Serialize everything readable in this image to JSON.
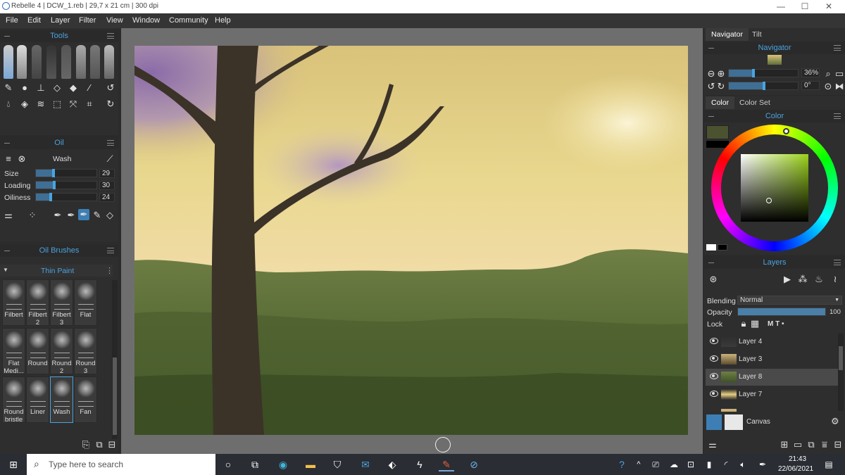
{
  "window": {
    "title": "Rebelle 4 | DCW_1.reb | 29,7 x 21 cm | 300 dpi",
    "min": "—",
    "max": "☐",
    "close": "✕"
  },
  "menu": [
    "File",
    "Edit",
    "Layer",
    "Filter",
    "View",
    "Window",
    "Community",
    "Help"
  ],
  "tools": {
    "title": "Tools"
  },
  "oil": {
    "title": "Oil",
    "mode": "Wash",
    "sliders": [
      {
        "label": "Size",
        "value": "29",
        "fraction": 0.29
      },
      {
        "label": "Loading",
        "value": "30",
        "fraction": 0.3
      },
      {
        "label": "Oiliness",
        "value": "24",
        "fraction": 0.24
      }
    ]
  },
  "brushes": {
    "title": "Oil Brushes",
    "category": "Thin Paint",
    "items": [
      {
        "label": "Filbert"
      },
      {
        "label": "Filbert 2"
      },
      {
        "label": "Filbert 3"
      },
      {
        "label": "Flat"
      },
      {
        "label": "Flat Medi..."
      },
      {
        "label": "Round"
      },
      {
        "label": "Round 2"
      },
      {
        "label": "Round 3"
      },
      {
        "label": "Round bristle"
      },
      {
        "label": "Liner"
      },
      {
        "label": "Wash"
      },
      {
        "label": "Fan"
      }
    ]
  },
  "navigator": {
    "tab1": "Navigator",
    "tab2": "Tilt",
    "title": "Navigator",
    "zoom": "36%",
    "rotation": "0°",
    "zoom_fraction": 0.36
  },
  "color": {
    "tab1": "Color",
    "tab2": "Color Set",
    "title": "Color",
    "current": "#4a5230",
    "accent": "#4aa3df"
  },
  "layers": {
    "title": "Layers",
    "blending_label": "Blending",
    "blending_value": "Normal",
    "opacity_label": "Opacity",
    "opacity_value": "100",
    "lock_label": "Lock",
    "lock_flags": "M T •",
    "items": [
      {
        "name": "Layer 4",
        "selected": false
      },
      {
        "name": "Layer 3",
        "selected": false
      },
      {
        "name": "Layer 8",
        "selected": true
      },
      {
        "name": "Layer 7",
        "selected": false
      }
    ],
    "canvas_label": "Canvas"
  },
  "taskbar": {
    "search_placeholder": "Type here to search",
    "time": "21:43",
    "date": "22/06/2021"
  }
}
